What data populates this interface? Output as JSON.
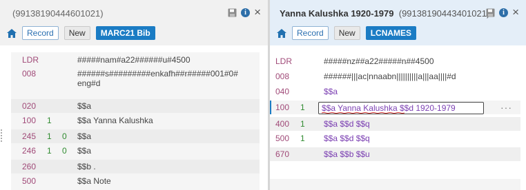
{
  "left": {
    "title": "(99138190444601021)",
    "buttons": {
      "record": "Record",
      "new": "New",
      "type": "MARC21 Bib"
    },
    "rows": [
      {
        "tag": "LDR",
        "ind1": "",
        "ind2": "",
        "value": "#####nam#a22######u#4500"
      },
      {
        "tag": "008",
        "ind1": "",
        "ind2": "",
        "value": "######s#########enkafh##r#####001#0#",
        "value2": "eng#d"
      },
      {
        "tag": "020",
        "ind1": "",
        "ind2": "",
        "value": "$$a"
      },
      {
        "tag": "100",
        "ind1": "1",
        "ind2": "",
        "value": "$$a Yanna Kalushka"
      },
      {
        "tag": "245",
        "ind1": "1",
        "ind2": "0",
        "value": "$$a"
      },
      {
        "tag": "246",
        "ind1": "1",
        "ind2": "0",
        "value": "$$a"
      },
      {
        "tag": "260",
        "ind1": "",
        "ind2": "",
        "value": "$$b ."
      },
      {
        "tag": "500",
        "ind1": "",
        "ind2": "",
        "value": "$$a Note"
      }
    ]
  },
  "right": {
    "title_bold": "Yanna Kalushka 1920-1979",
    "title": "(99138190443401021)",
    "buttons": {
      "record": "Record",
      "new": "New",
      "type": "LCNAMES"
    },
    "rows": [
      {
        "tag": "LDR",
        "ind1": "",
        "value": "#####nz##a22#####n##4500"
      },
      {
        "tag": "008",
        "ind1": "",
        "value": "######|||ac|nnaabn||||||||||a|||aa||||#d"
      },
      {
        "tag": "040",
        "ind1": "",
        "value": "$$a"
      },
      {
        "tag": "100",
        "ind1": "1",
        "value": "$$a Yanna Kalushka $$d 1920-1979"
      },
      {
        "tag": "400",
        "ind1": "1",
        "value": "$$a $$d $$q"
      },
      {
        "tag": "500",
        "ind1": "1",
        "value": "$$a $$d $$q"
      },
      {
        "tag": "670",
        "ind1": "",
        "value": "$$a $$b $$u"
      }
    ],
    "more": "···"
  },
  "colors": {
    "accent": "#1b7cc4",
    "tag": "#a04a78",
    "indicator": "#2f8a2f",
    "subfield": "#7b3fb2"
  },
  "icons": [
    "home-icon",
    "save-icon",
    "info-icon",
    "close-icon",
    "more-icon"
  ]
}
